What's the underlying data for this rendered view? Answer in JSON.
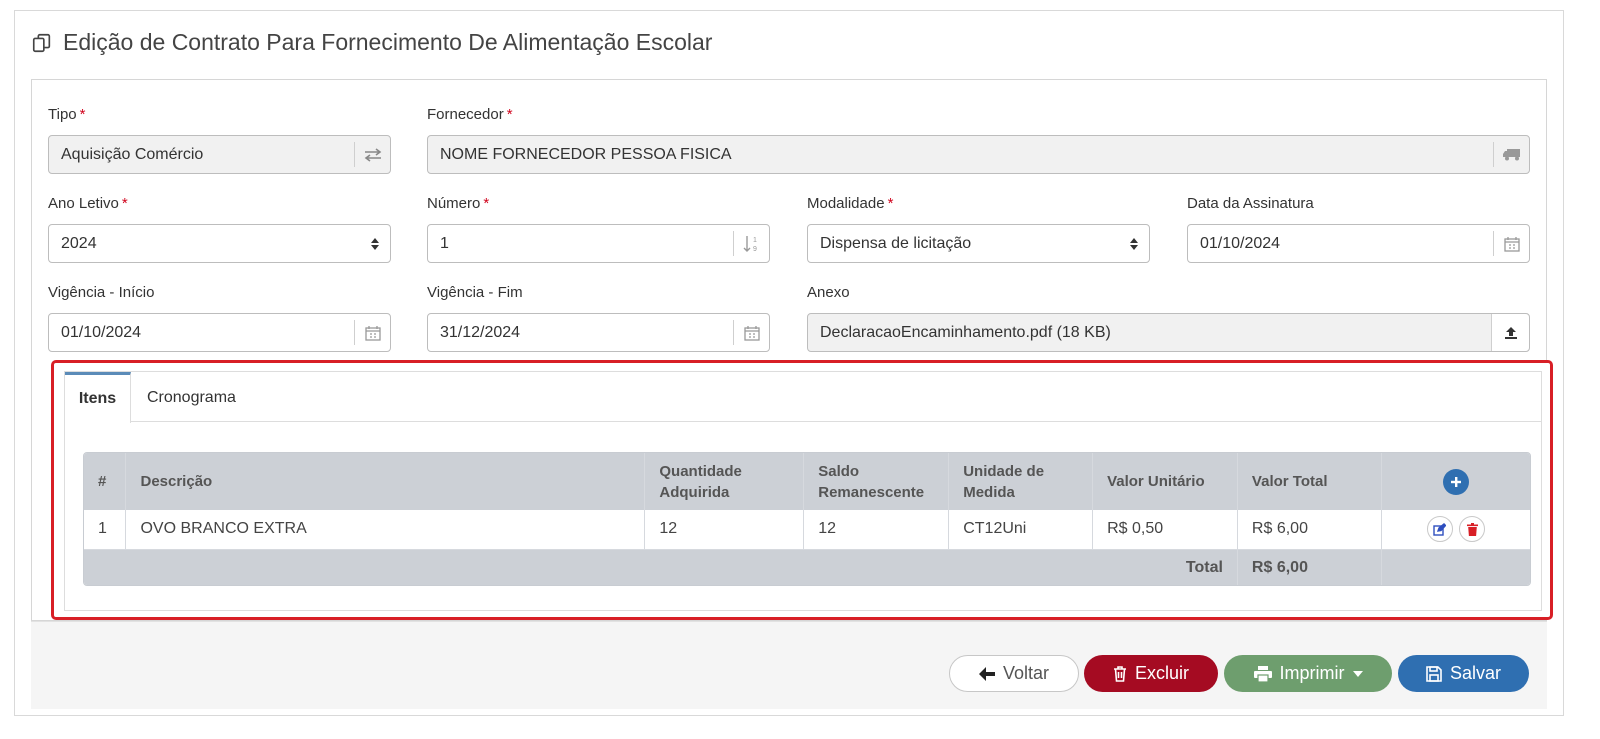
{
  "page": {
    "title": "Edição de Contrato Para Fornecimento De Alimentação Escolar"
  },
  "form": {
    "tipo": {
      "label": "Tipo",
      "value": "Aquisição Comércio"
    },
    "fornecedor": {
      "label": "Fornecedor",
      "value": "NOME FORNECEDOR PESSOA FISICA"
    },
    "ano_letivo": {
      "label": "Ano Letivo",
      "value": "2024"
    },
    "numero": {
      "label": "Número",
      "value": "1"
    },
    "modalidade": {
      "label": "Modalidade",
      "value": "Dispensa de licitação"
    },
    "data_assinatura": {
      "label": "Data da Assinatura",
      "value": "01/10/2024"
    },
    "vigencia_inicio": {
      "label": "Vigência - Início",
      "value": "01/10/2024"
    },
    "vigencia_fim": {
      "label": "Vigência - Fim",
      "value": "31/12/2024"
    },
    "anexo": {
      "label": "Anexo",
      "value": "DeclaracaoEncaminhamento.pdf (18 KB)"
    },
    "required_marker": "*"
  },
  "tabs": [
    {
      "label": "Itens",
      "active": true
    },
    {
      "label": "Cronograma",
      "active": false
    }
  ],
  "items_table": {
    "headers": {
      "num": "#",
      "descricao": "Descrição",
      "qtd": [
        "Quantidade",
        "Adquirida"
      ],
      "saldo": [
        "Saldo",
        "Remanescente"
      ],
      "unidade": [
        "Unidade de",
        "Medida"
      ],
      "valor_unit": "Valor Unitário",
      "valor_total": "Valor Total"
    },
    "rows": [
      {
        "num": "1",
        "descricao": "OVO BRANCO EXTRA",
        "qtd": "12",
        "saldo": "12",
        "unidade": "CT12Uni",
        "valor_unit": "R$ 0,50",
        "valor_total": "R$ 6,00"
      }
    ],
    "footer": {
      "label": "Total",
      "value": "R$ 6,00"
    }
  },
  "actions": {
    "voltar": "Voltar",
    "excluir": "Excluir",
    "imprimir": "Imprimir",
    "salvar": "Salvar"
  },
  "colors": {
    "primary": "#2f6fb1",
    "danger": "#a50b22",
    "success": "#6e9e6e",
    "highlight": "#d81f26"
  }
}
